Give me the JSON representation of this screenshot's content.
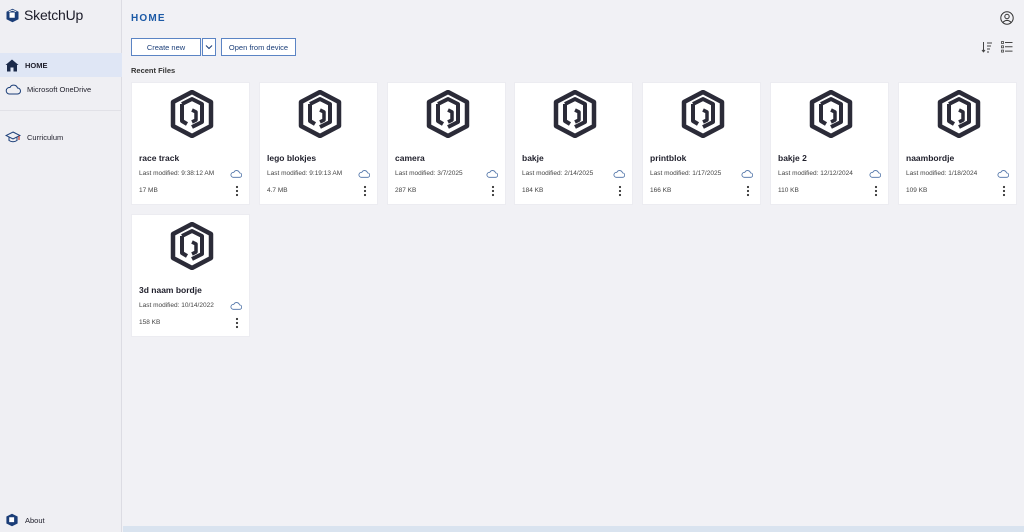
{
  "app": {
    "name": "SketchUp"
  },
  "sidebar": {
    "items": [
      {
        "label": "HOME",
        "icon": "home-icon",
        "active": true
      },
      {
        "label": "Microsoft OneDrive",
        "icon": "cloud-icon"
      },
      {
        "label": "Curriculum",
        "icon": "graduation-cap-icon"
      }
    ],
    "about": {
      "label": "About",
      "icon": "sketchup-logo-icon"
    }
  },
  "main": {
    "title": "HOME",
    "create_new_label": "Create new",
    "open_from_device_label": "Open from device",
    "section_title": "Recent Files",
    "files": [
      {
        "name": "race track",
        "modified": "Last modified: 9:38:12 AM",
        "size": "17 MB"
      },
      {
        "name": "lego blokjes",
        "modified": "Last modified: 9:19:13 AM",
        "size": "4.7 MB"
      },
      {
        "name": "camera",
        "modified": "Last modified: 3/7/2025",
        "size": "287 KB"
      },
      {
        "name": "bakje",
        "modified": "Last modified: 2/14/2025",
        "size": "184 KB"
      },
      {
        "name": "printblok",
        "modified": "Last modified: 1/17/2025",
        "size": "166 KB"
      },
      {
        "name": "bakje 2",
        "modified": "Last modified: 12/12/2024",
        "size": "110 KB"
      },
      {
        "name": "naambordje",
        "modified": "Last modified: 1/18/2024",
        "size": "109 KB"
      },
      {
        "name": "3d naam bordje",
        "modified": "Last modified: 10/14/2022",
        "size": "158 KB"
      }
    ]
  },
  "colors": {
    "accent": "#1c5aa6",
    "sidebar_active": "#dfe6f5",
    "background": "#f1f1f5",
    "logo": "#1b3e78"
  }
}
